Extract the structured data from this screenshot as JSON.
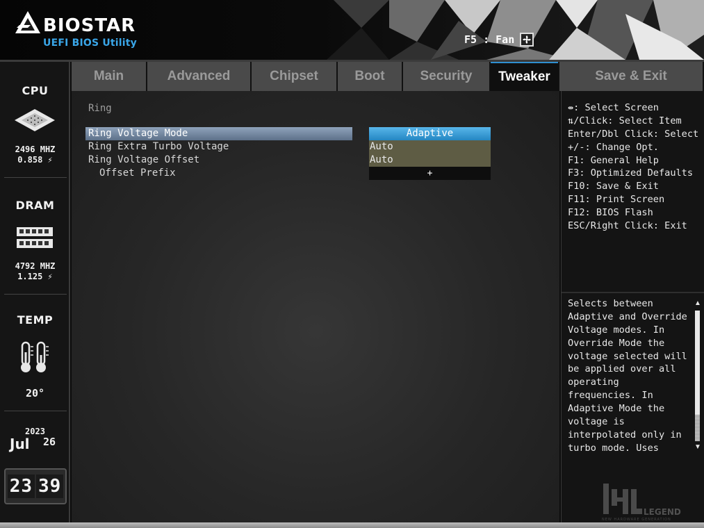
{
  "header": {
    "brand": "BIOSTAR",
    "subtitle": "UEFI BIOS Utility",
    "fan_label": "F5 : Fan",
    "accent": "#3aa6e8"
  },
  "sidebar": {
    "cpu": {
      "title": "CPU",
      "freq": "2496 MHZ",
      "volt": "0.858 ⚡"
    },
    "dram": {
      "title": "DRAM",
      "freq": "4792 MHZ",
      "volt": "1.125 ⚡"
    },
    "temp": {
      "title": "TEMP",
      "value": "20°"
    },
    "date": {
      "year": "2023",
      "month": "Jul",
      "day": "26"
    },
    "clock": {
      "hours": "23",
      "minutes": "39"
    }
  },
  "tabs": [
    {
      "label": "Main",
      "active": false
    },
    {
      "label": "Advanced",
      "active": false
    },
    {
      "label": "Chipset",
      "active": false
    },
    {
      "label": "Boot",
      "active": false
    },
    {
      "label": "Security",
      "active": false
    },
    {
      "label": "Tweaker",
      "active": true
    },
    {
      "label": "Save & Exit",
      "active": false
    }
  ],
  "main": {
    "section_title": "Ring",
    "rows": [
      {
        "label": "Ring Voltage Mode",
        "value": "Adaptive",
        "selected": true
      },
      {
        "label": "Ring Extra Turbo Voltage",
        "value": "Auto"
      },
      {
        "label": "Ring Voltage Offset",
        "value": "Auto"
      },
      {
        "label": "Offset Prefix",
        "value": "+"
      }
    ]
  },
  "help": {
    "keys": [
      "⇹: Select Screen",
      "⇅/Click: Select Item",
      "Enter/Dbl Click: Select",
      "+/-: Change Opt.",
      "F1: General Help",
      "F3: Optimized Defaults",
      "F10: Save & Exit",
      "F11: Print Screen",
      "F12: BIOS Flash",
      "ESC/Right Click: Exit"
    ],
    "description": [
      "Selects between",
      "Adaptive and Override",
      "Voltage modes. In",
      "Override Mode the",
      "voltage selected will",
      "be applied over all",
      "operating",
      "frequencies. In",
      "Adaptive Mode the",
      "voltage is",
      "interpolated only in",
      "turbo mode. Uses"
    ]
  },
  "watermark": {
    "name": "LEGEND",
    "tagline": "NEW HARDWARE GENERATION"
  }
}
